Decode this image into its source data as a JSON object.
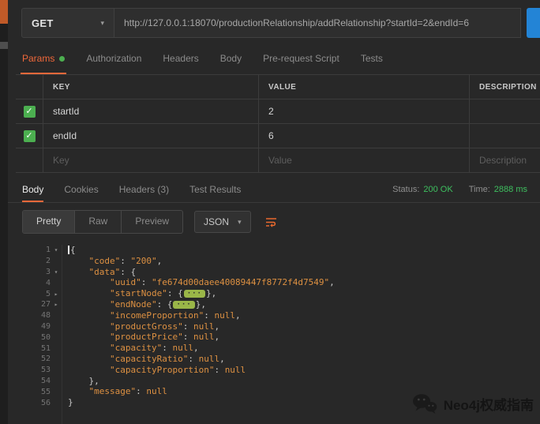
{
  "request": {
    "method": "GET",
    "url": "http://127.0.0.1:18070/productionRelationship/addRelationship?startId=2&endId=6"
  },
  "request_tabs": [
    {
      "label": "Params",
      "active": true,
      "has_dot": true
    },
    {
      "label": "Authorization",
      "active": false
    },
    {
      "label": "Headers",
      "active": false
    },
    {
      "label": "Body",
      "active": false
    },
    {
      "label": "Pre-request Script",
      "active": false
    },
    {
      "label": "Tests",
      "active": false
    }
  ],
  "params_table": {
    "headers": {
      "key": "KEY",
      "value": "VALUE",
      "description": "DESCRIPTION"
    },
    "rows": [
      {
        "key": "startId",
        "value": "2",
        "description": "",
        "checked": true
      },
      {
        "key": "endId",
        "value": "6",
        "description": "",
        "checked": true
      }
    ],
    "new_row_placeholders": {
      "key": "Key",
      "value": "Value",
      "description": "Description"
    }
  },
  "response": {
    "tabs": [
      {
        "label": "Body",
        "active": true
      },
      {
        "label": "Cookies",
        "active": false
      },
      {
        "label": "Headers (3)",
        "active": false
      },
      {
        "label": "Test Results",
        "active": false
      }
    ],
    "status_label": "Status:",
    "status_value": "200 OK",
    "time_label": "Time:",
    "time_value": "2888 ms",
    "view_modes": {
      "pretty": "Pretty",
      "raw": "Raw",
      "preview": "Preview",
      "active": "Pretty"
    },
    "format_select": "JSON"
  },
  "editor": {
    "lines": [
      {
        "num": "1",
        "fold": "open",
        "parts": [
          [
            "c",
            ""
          ],
          [
            "p",
            "{"
          ]
        ]
      },
      {
        "num": "2",
        "fold": "",
        "parts": [
          [
            "p",
            "    "
          ],
          [
            "k",
            "\"code\""
          ],
          [
            "p",
            ": "
          ],
          [
            "s",
            "\"200\""
          ],
          [
            "p",
            ","
          ]
        ]
      },
      {
        "num": "3",
        "fold": "open",
        "parts": [
          [
            "p",
            "    "
          ],
          [
            "k",
            "\"data\""
          ],
          [
            "p",
            ": {"
          ]
        ]
      },
      {
        "num": "4",
        "fold": "",
        "parts": [
          [
            "p",
            "        "
          ],
          [
            "k",
            "\"uuid\""
          ],
          [
            "p",
            ": "
          ],
          [
            "s",
            "\"fe674d00daee40089447f8772f4d7549\""
          ],
          [
            "p",
            ","
          ]
        ]
      },
      {
        "num": "5",
        "fold": "closed",
        "parts": [
          [
            "p",
            "        "
          ],
          [
            "k",
            "\"startNode\""
          ],
          [
            "p",
            ": {"
          ],
          [
            "b",
            ""
          ],
          [
            "p",
            "},"
          ]
        ]
      },
      {
        "num": "27",
        "fold": "closed",
        "parts": [
          [
            "p",
            "        "
          ],
          [
            "k",
            "\"endNode\""
          ],
          [
            "p",
            ": {"
          ],
          [
            "b",
            ""
          ],
          [
            "p",
            "},"
          ]
        ]
      },
      {
        "num": "48",
        "fold": "",
        "parts": [
          [
            "p",
            "        "
          ],
          [
            "k",
            "\"incomeProportion\""
          ],
          [
            "p",
            ": "
          ],
          [
            "n",
            "null"
          ],
          [
            "p",
            ","
          ]
        ]
      },
      {
        "num": "49",
        "fold": "",
        "parts": [
          [
            "p",
            "        "
          ],
          [
            "k",
            "\"productGross\""
          ],
          [
            "p",
            ": "
          ],
          [
            "n",
            "null"
          ],
          [
            "p",
            ","
          ]
        ]
      },
      {
        "num": "50",
        "fold": "",
        "parts": [
          [
            "p",
            "        "
          ],
          [
            "k",
            "\"productPrice\""
          ],
          [
            "p",
            ": "
          ],
          [
            "n",
            "null"
          ],
          [
            "p",
            ","
          ]
        ]
      },
      {
        "num": "51",
        "fold": "",
        "parts": [
          [
            "p",
            "        "
          ],
          [
            "k",
            "\"capacity\""
          ],
          [
            "p",
            ": "
          ],
          [
            "n",
            "null"
          ],
          [
            "p",
            ","
          ]
        ]
      },
      {
        "num": "52",
        "fold": "",
        "parts": [
          [
            "p",
            "        "
          ],
          [
            "k",
            "\"capacityRatio\""
          ],
          [
            "p",
            ": "
          ],
          [
            "n",
            "null"
          ],
          [
            "p",
            ","
          ]
        ]
      },
      {
        "num": "53",
        "fold": "",
        "parts": [
          [
            "p",
            "        "
          ],
          [
            "k",
            "\"capacityProportion\""
          ],
          [
            "p",
            ": "
          ],
          [
            "n",
            "null"
          ]
        ]
      },
      {
        "num": "54",
        "fold": "",
        "parts": [
          [
            "p",
            "    },"
          ]
        ]
      },
      {
        "num": "55",
        "fold": "",
        "parts": [
          [
            "p",
            "    "
          ],
          [
            "k",
            "\"message\""
          ],
          [
            "p",
            ": "
          ],
          [
            "n",
            "null"
          ]
        ]
      },
      {
        "num": "56",
        "fold": "",
        "parts": [
          [
            "p",
            "}"
          ]
        ]
      }
    ]
  },
  "watermark": {
    "text": "Neo4j权威指南"
  },
  "colors": {
    "accent_orange": "#f0683a",
    "status_green": "#3ebf5f",
    "json_orange": "#de9142",
    "badge_green": "#9ab648",
    "send_blue": "#2384d6",
    "checkbox_green": "#4caf50"
  }
}
